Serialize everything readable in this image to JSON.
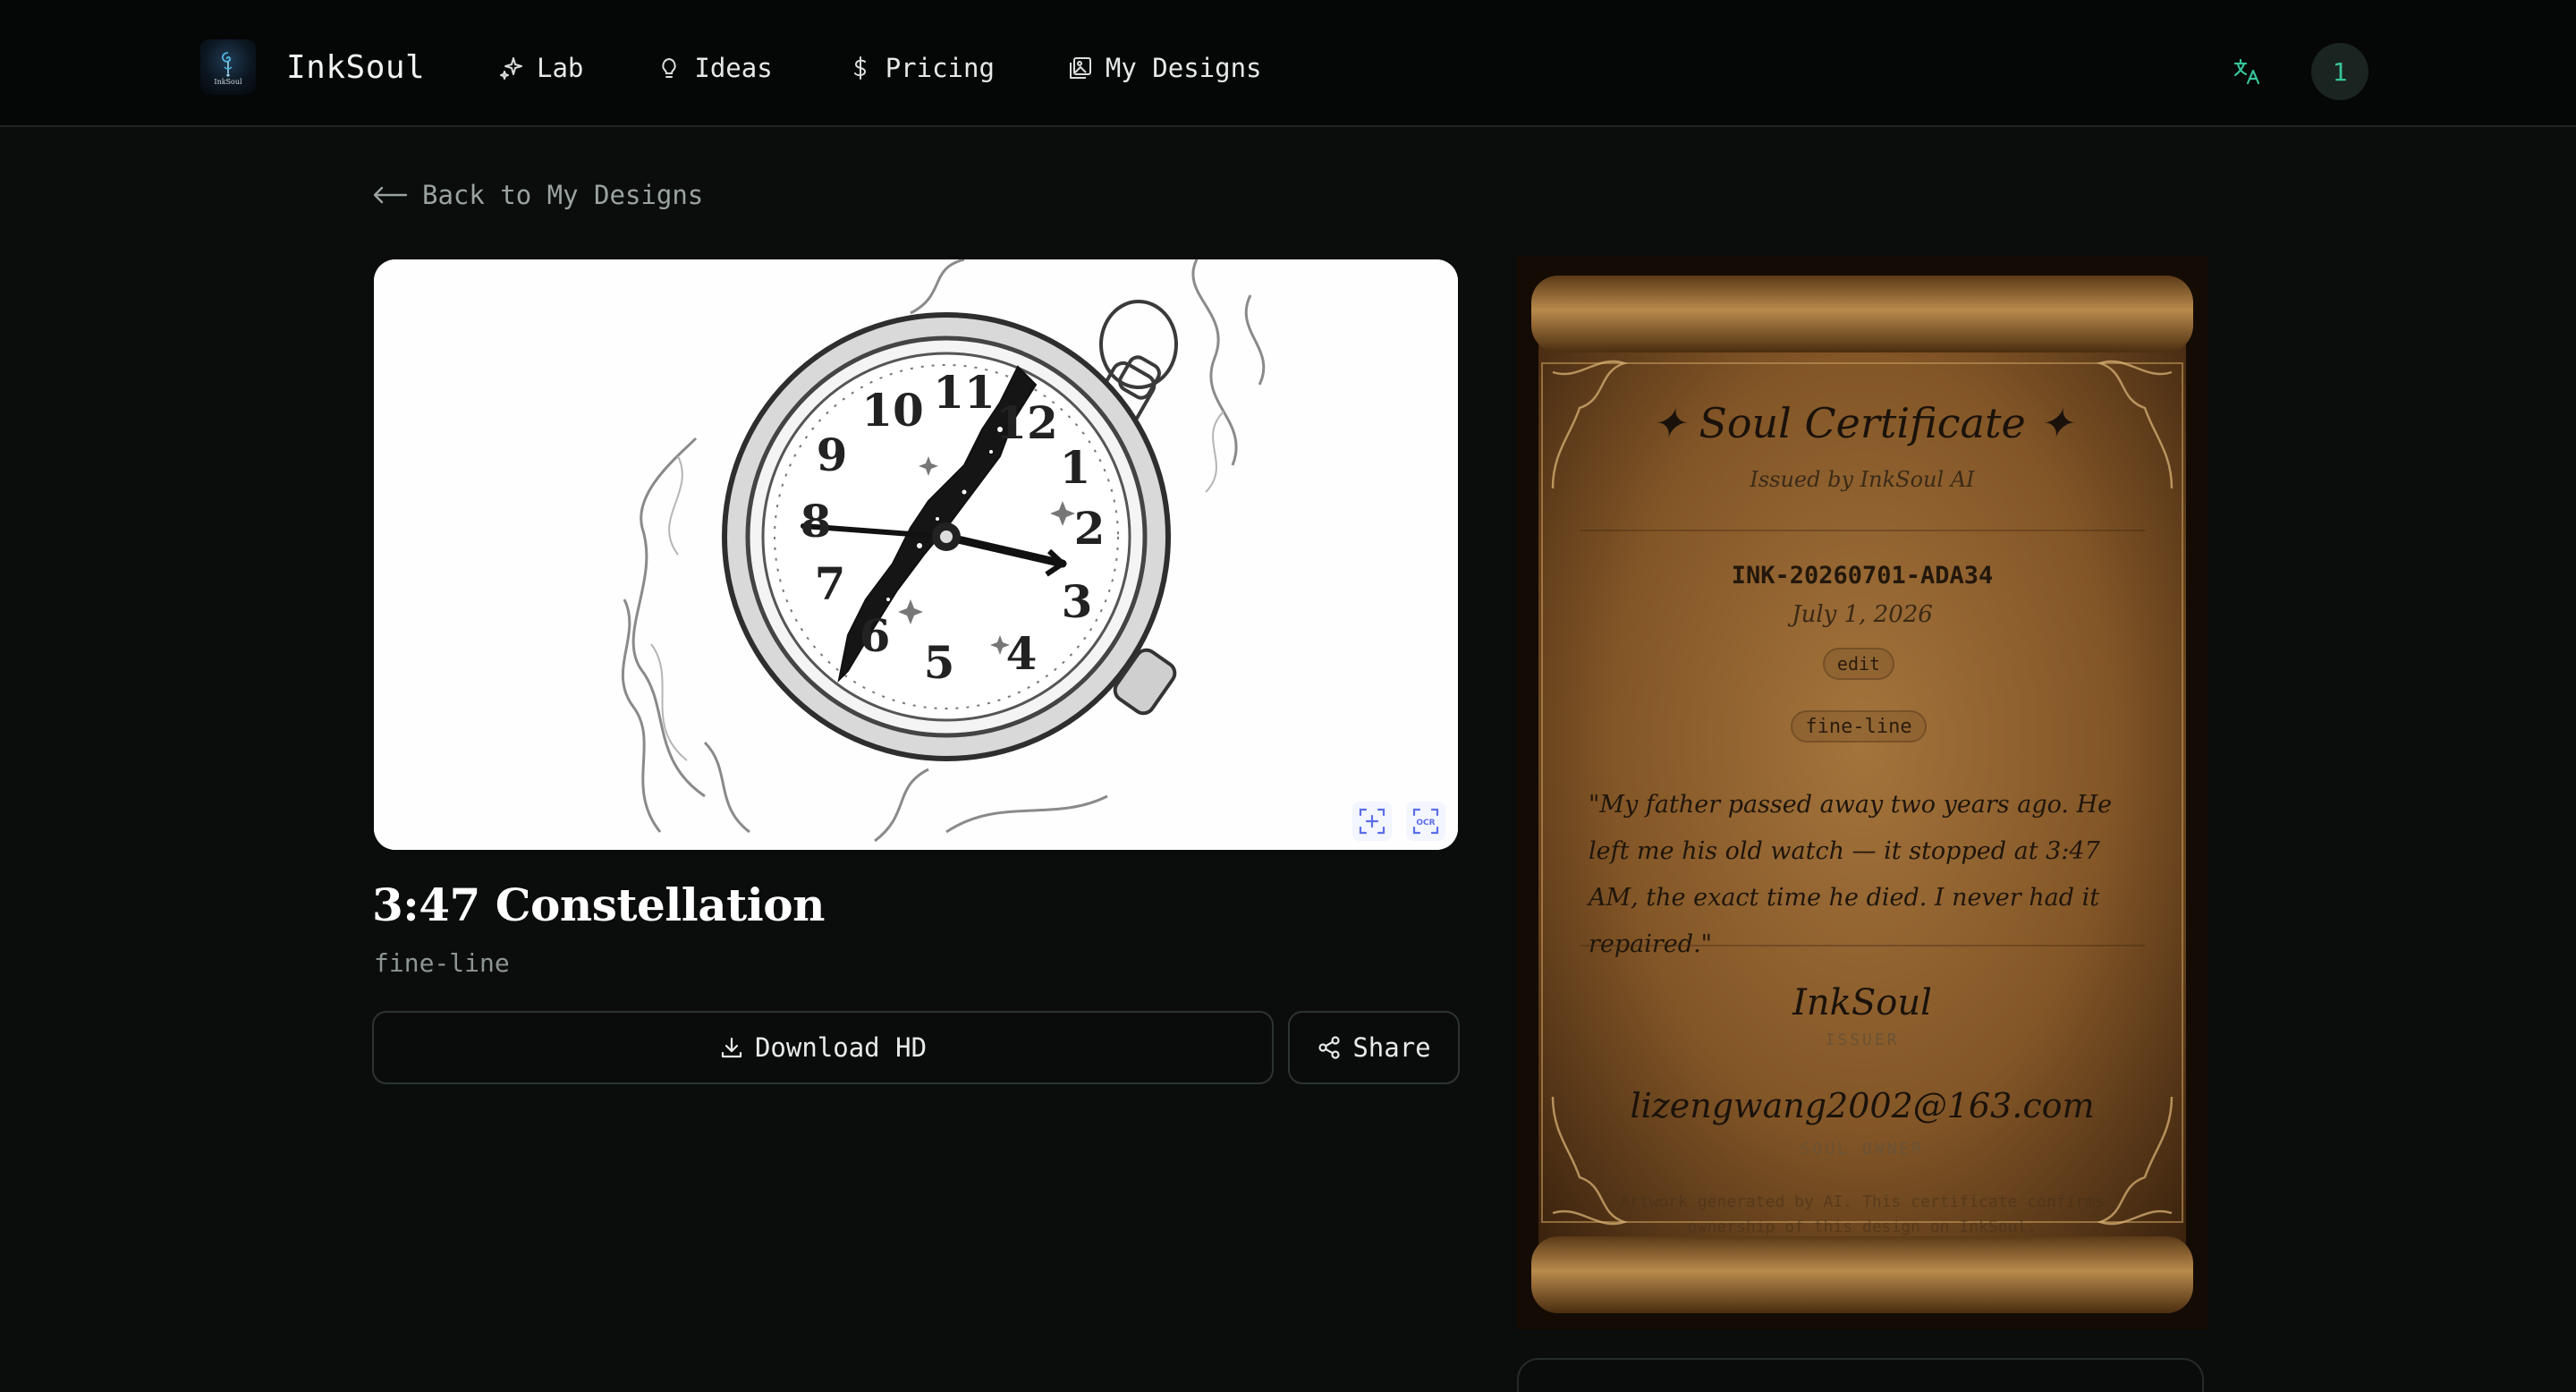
{
  "app": {
    "name": "InkSoul",
    "logo_text": "InkSoul",
    "logo_icon": "inksoul-logo-icon"
  },
  "nav": {
    "items": [
      {
        "label": "Lab",
        "icon": "sparkles-icon"
      },
      {
        "label": "Ideas",
        "icon": "lightbulb-icon"
      },
      {
        "label": "Pricing",
        "icon": "dollar-icon"
      },
      {
        "label": "My Designs",
        "icon": "gallery-icon"
      }
    ],
    "language_icon": "translate-icon",
    "avatar_label": "1",
    "accent_color": "#37c39a"
  },
  "back": {
    "label": "Back to My Designs",
    "icon": "arrow-left-icon"
  },
  "design": {
    "title": "3:47 Constellation",
    "style": "fine-line",
    "image_alt": "pocket-watch-tattoo-illustration",
    "clock_numerals": [
      "12",
      "1",
      "2",
      "3",
      "4",
      "5",
      "6",
      "7",
      "8",
      "9",
      "10",
      "11"
    ],
    "image_tools": [
      {
        "icon": "zoom-scan-icon"
      },
      {
        "icon": "ocr-icon",
        "label": "OCR"
      }
    ]
  },
  "actions": {
    "download_label": "Download HD",
    "download_icon": "download-icon",
    "share_label": "Share",
    "share_icon": "share-icon"
  },
  "certificate": {
    "title": "✦ Soul Certificate ✦",
    "issued_by": "Issued by InkSoul AI",
    "id": "INK-20260701-ADA34",
    "date": "July 1, 2026",
    "edit_label": "edit",
    "style_tag": "fine-line",
    "quote": "\"My father passed away two years ago. He left me his old watch — it stopped at 3:47 AM, the exact time he died. I never had it repaired.\"",
    "issuer_signature": "InkSoul",
    "issuer_role": "ISSUER",
    "owner_signature": "lizengwang2002@163.com",
    "owner_role": "SOUL OWNER",
    "fine_print": "Artwork generated by AI. This certificate confirms ownership of this design on InkSoul."
  }
}
